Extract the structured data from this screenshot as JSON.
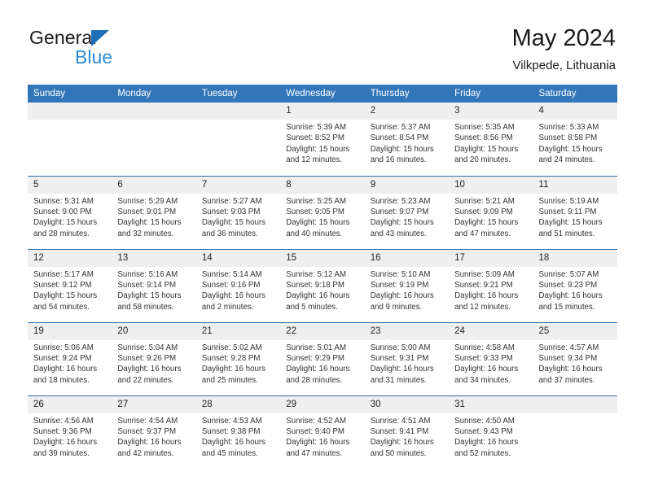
{
  "brand": {
    "name_top": "General",
    "name_bottom": "Blue",
    "accent_color": "#2e8ad6",
    "triangle_color": "#1f6fb8"
  },
  "header": {
    "title": "May 2024",
    "subtitle": "Vilkpede, Lithuania"
  },
  "theme": {
    "header_row_bg": "#3275b8",
    "header_row_text": "#ffffff",
    "row_divider": "#2d6fae",
    "daynum_bg": "#efefef",
    "body_text": "#333333"
  },
  "weekday_headers": [
    "Sunday",
    "Monday",
    "Tuesday",
    "Wednesday",
    "Thursday",
    "Friday",
    "Saturday"
  ],
  "weeks": [
    [
      {
        "day": "",
        "empty": true,
        "lines": []
      },
      {
        "day": "",
        "empty": true,
        "lines": []
      },
      {
        "day": "",
        "empty": true,
        "lines": []
      },
      {
        "day": "1",
        "empty": false,
        "lines": [
          "Sunrise: 5:39 AM",
          "Sunset: 8:52 PM",
          "Daylight: 15 hours",
          "and 12 minutes."
        ]
      },
      {
        "day": "2",
        "empty": false,
        "lines": [
          "Sunrise: 5:37 AM",
          "Sunset: 8:54 PM",
          "Daylight: 15 hours",
          "and 16 minutes."
        ]
      },
      {
        "day": "3",
        "empty": false,
        "lines": [
          "Sunrise: 5:35 AM",
          "Sunset: 8:56 PM",
          "Daylight: 15 hours",
          "and 20 minutes."
        ]
      },
      {
        "day": "4",
        "empty": false,
        "lines": [
          "Sunrise: 5:33 AM",
          "Sunset: 8:58 PM",
          "Daylight: 15 hours",
          "and 24 minutes."
        ]
      }
    ],
    [
      {
        "day": "5",
        "empty": false,
        "lines": [
          "Sunrise: 5:31 AM",
          "Sunset: 9:00 PM",
          "Daylight: 15 hours",
          "and 28 minutes."
        ]
      },
      {
        "day": "6",
        "empty": false,
        "lines": [
          "Sunrise: 5:29 AM",
          "Sunset: 9:01 PM",
          "Daylight: 15 hours",
          "and 32 minutes."
        ]
      },
      {
        "day": "7",
        "empty": false,
        "lines": [
          "Sunrise: 5:27 AM",
          "Sunset: 9:03 PM",
          "Daylight: 15 hours",
          "and 36 minutes."
        ]
      },
      {
        "day": "8",
        "empty": false,
        "lines": [
          "Sunrise: 5:25 AM",
          "Sunset: 9:05 PM",
          "Daylight: 15 hours",
          "and 40 minutes."
        ]
      },
      {
        "day": "9",
        "empty": false,
        "lines": [
          "Sunrise: 5:23 AM",
          "Sunset: 9:07 PM",
          "Daylight: 15 hours",
          "and 43 minutes."
        ]
      },
      {
        "day": "10",
        "empty": false,
        "lines": [
          "Sunrise: 5:21 AM",
          "Sunset: 9:09 PM",
          "Daylight: 15 hours",
          "and 47 minutes."
        ]
      },
      {
        "day": "11",
        "empty": false,
        "lines": [
          "Sunrise: 5:19 AM",
          "Sunset: 9:11 PM",
          "Daylight: 15 hours",
          "and 51 minutes."
        ]
      }
    ],
    [
      {
        "day": "12",
        "empty": false,
        "lines": [
          "Sunrise: 5:17 AM",
          "Sunset: 9:12 PM",
          "Daylight: 15 hours",
          "and 54 minutes."
        ]
      },
      {
        "day": "13",
        "empty": false,
        "lines": [
          "Sunrise: 5:16 AM",
          "Sunset: 9:14 PM",
          "Daylight: 15 hours",
          "and 58 minutes."
        ]
      },
      {
        "day": "14",
        "empty": false,
        "lines": [
          "Sunrise: 5:14 AM",
          "Sunset: 9:16 PM",
          "Daylight: 16 hours",
          "and 2 minutes."
        ]
      },
      {
        "day": "15",
        "empty": false,
        "lines": [
          "Sunrise: 5:12 AM",
          "Sunset: 9:18 PM",
          "Daylight: 16 hours",
          "and 5 minutes."
        ]
      },
      {
        "day": "16",
        "empty": false,
        "lines": [
          "Sunrise: 5:10 AM",
          "Sunset: 9:19 PM",
          "Daylight: 16 hours",
          "and 9 minutes."
        ]
      },
      {
        "day": "17",
        "empty": false,
        "lines": [
          "Sunrise: 5:09 AM",
          "Sunset: 9:21 PM",
          "Daylight: 16 hours",
          "and 12 minutes."
        ]
      },
      {
        "day": "18",
        "empty": false,
        "lines": [
          "Sunrise: 5:07 AM",
          "Sunset: 9:23 PM",
          "Daylight: 16 hours",
          "and 15 minutes."
        ]
      }
    ],
    [
      {
        "day": "19",
        "empty": false,
        "lines": [
          "Sunrise: 5:06 AM",
          "Sunset: 9:24 PM",
          "Daylight: 16 hours",
          "and 18 minutes."
        ]
      },
      {
        "day": "20",
        "empty": false,
        "lines": [
          "Sunrise: 5:04 AM",
          "Sunset: 9:26 PM",
          "Daylight: 16 hours",
          "and 22 minutes."
        ]
      },
      {
        "day": "21",
        "empty": false,
        "lines": [
          "Sunrise: 5:02 AM",
          "Sunset: 9:28 PM",
          "Daylight: 16 hours",
          "and 25 minutes."
        ]
      },
      {
        "day": "22",
        "empty": false,
        "lines": [
          "Sunrise: 5:01 AM",
          "Sunset: 9:29 PM",
          "Daylight: 16 hours",
          "and 28 minutes."
        ]
      },
      {
        "day": "23",
        "empty": false,
        "lines": [
          "Sunrise: 5:00 AM",
          "Sunset: 9:31 PM",
          "Daylight: 16 hours",
          "and 31 minutes."
        ]
      },
      {
        "day": "24",
        "empty": false,
        "lines": [
          "Sunrise: 4:58 AM",
          "Sunset: 9:33 PM",
          "Daylight: 16 hours",
          "and 34 minutes."
        ]
      },
      {
        "day": "25",
        "empty": false,
        "lines": [
          "Sunrise: 4:57 AM",
          "Sunset: 9:34 PM",
          "Daylight: 16 hours",
          "and 37 minutes."
        ]
      }
    ],
    [
      {
        "day": "26",
        "empty": false,
        "lines": [
          "Sunrise: 4:56 AM",
          "Sunset: 9:36 PM",
          "Daylight: 16 hours",
          "and 39 minutes."
        ]
      },
      {
        "day": "27",
        "empty": false,
        "lines": [
          "Sunrise: 4:54 AM",
          "Sunset: 9:37 PM",
          "Daylight: 16 hours",
          "and 42 minutes."
        ]
      },
      {
        "day": "28",
        "empty": false,
        "lines": [
          "Sunrise: 4:53 AM",
          "Sunset: 9:38 PM",
          "Daylight: 16 hours",
          "and 45 minutes."
        ]
      },
      {
        "day": "29",
        "empty": false,
        "lines": [
          "Sunrise: 4:52 AM",
          "Sunset: 9:40 PM",
          "Daylight: 16 hours",
          "and 47 minutes."
        ]
      },
      {
        "day": "30",
        "empty": false,
        "lines": [
          "Sunrise: 4:51 AM",
          "Sunset: 9:41 PM",
          "Daylight: 16 hours",
          "and 50 minutes."
        ]
      },
      {
        "day": "31",
        "empty": false,
        "lines": [
          "Sunrise: 4:50 AM",
          "Sunset: 9:43 PM",
          "Daylight: 16 hours",
          "and 52 minutes."
        ]
      },
      {
        "day": "",
        "empty": true,
        "lines": []
      }
    ]
  ]
}
